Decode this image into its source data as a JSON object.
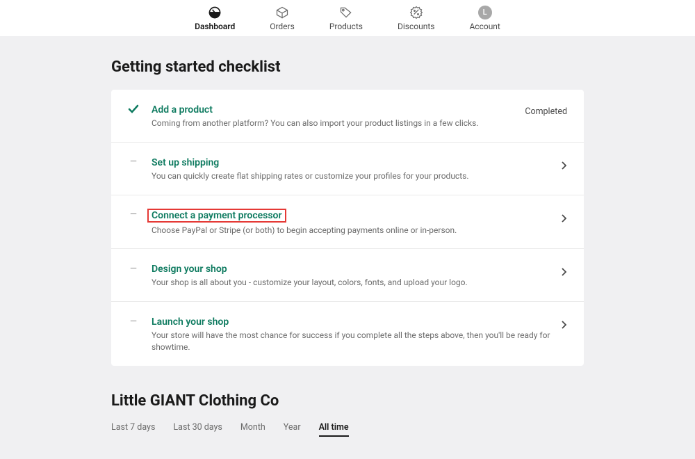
{
  "nav": {
    "items": [
      {
        "label": "Dashboard",
        "icon": "dashboard",
        "active": true
      },
      {
        "label": "Orders",
        "icon": "orders"
      },
      {
        "label": "Products",
        "icon": "products"
      },
      {
        "label": "Discounts",
        "icon": "discounts"
      },
      {
        "label": "Account",
        "icon": "account",
        "avatar": "L"
      }
    ]
  },
  "page": {
    "title": "Getting started checklist"
  },
  "checklist": [
    {
      "title": "Add a product",
      "desc": "Coming from another platform? You can also import your product listings in a few clicks.",
      "status": "completed",
      "rightLabel": "Completed"
    },
    {
      "title": "Set up shipping",
      "desc": "You can quickly create flat shipping rates or customize your profiles for your products.",
      "status": "pending"
    },
    {
      "title": "Connect a payment processor",
      "desc": "Choose PayPal or Stripe (or both) to begin accepting payments online or in-person.",
      "status": "pending",
      "highlighted": true
    },
    {
      "title": "Design your shop",
      "desc": "Your shop is all about you - customize your layout, colors, fonts, and upload your logo.",
      "status": "pending"
    },
    {
      "title": "Launch your shop",
      "desc": "Your store will have the most chance for success if you complete all the steps above, then you'll be ready for showtime.",
      "status": "pending"
    }
  ],
  "store": {
    "name": "Little GIANT Clothing Co"
  },
  "timeTabs": [
    {
      "label": "Last 7 days"
    },
    {
      "label": "Last 30 days"
    },
    {
      "label": "Month"
    },
    {
      "label": "Year"
    },
    {
      "label": "All time",
      "active": true
    }
  ]
}
